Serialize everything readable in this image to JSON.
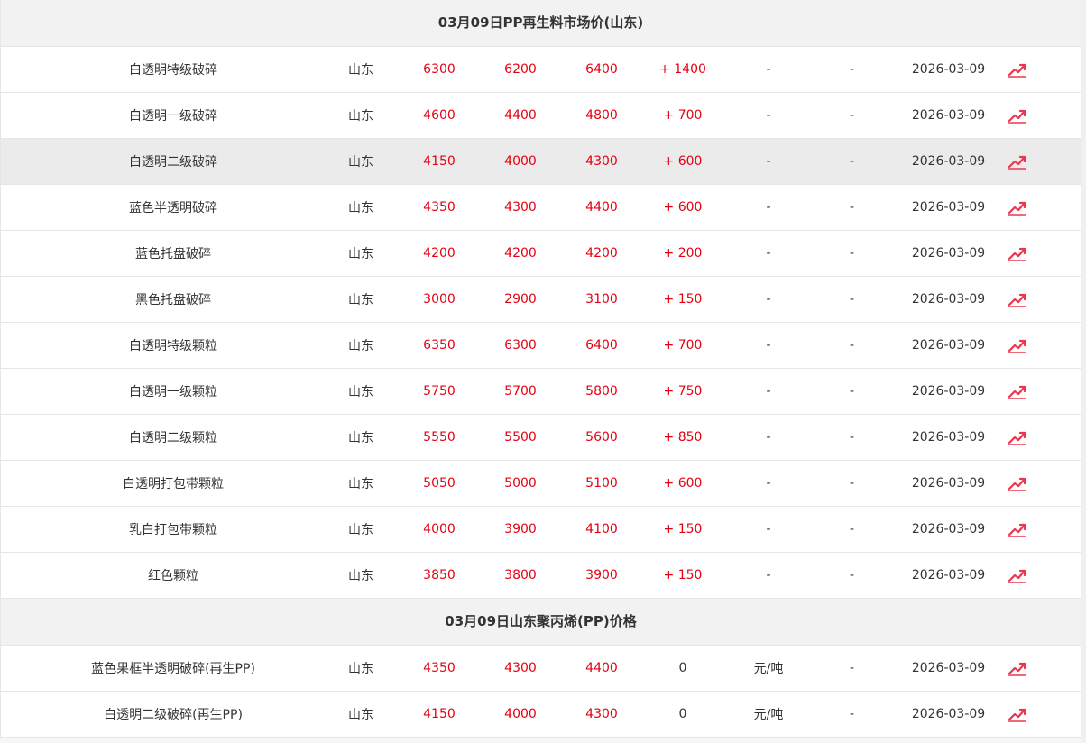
{
  "sections": [
    {
      "title": "03月09日PP再生料市场价(山东)",
      "rows": [
        {
          "name": "白透明特级破碎",
          "region": "山东",
          "p1": "6300",
          "p2": "6200",
          "p3": "6400",
          "change": "+ 1400",
          "unit": "-",
          "note": "-",
          "date": "2026-03-09"
        },
        {
          "name": "白透明一级破碎",
          "region": "山东",
          "p1": "4600",
          "p2": "4400",
          "p3": "4800",
          "change": "+ 700",
          "unit": "-",
          "note": "-",
          "date": "2026-03-09"
        },
        {
          "name": "白透明二级破碎",
          "region": "山东",
          "p1": "4150",
          "p2": "4000",
          "p3": "4300",
          "change": "+ 600",
          "unit": "-",
          "note": "-",
          "date": "2026-03-09"
        },
        {
          "name": "蓝色半透明破碎",
          "region": "山东",
          "p1": "4350",
          "p2": "4300",
          "p3": "4400",
          "change": "+ 600",
          "unit": "-",
          "note": "-",
          "date": "2026-03-09"
        },
        {
          "name": "蓝色托盘破碎",
          "region": "山东",
          "p1": "4200",
          "p2": "4200",
          "p3": "4200",
          "change": "+ 200",
          "unit": "-",
          "note": "-",
          "date": "2026-03-09"
        },
        {
          "name": "黑色托盘破碎",
          "region": "山东",
          "p1": "3000",
          "p2": "2900",
          "p3": "3100",
          "change": "+ 150",
          "unit": "-",
          "note": "-",
          "date": "2026-03-09"
        },
        {
          "name": "白透明特级颗粒",
          "region": "山东",
          "p1": "6350",
          "p2": "6300",
          "p3": "6400",
          "change": "+ 700",
          "unit": "-",
          "note": "-",
          "date": "2026-03-09"
        },
        {
          "name": "白透明一级颗粒",
          "region": "山东",
          "p1": "5750",
          "p2": "5700",
          "p3": "5800",
          "change": "+ 750",
          "unit": "-",
          "note": "-",
          "date": "2026-03-09"
        },
        {
          "name": "白透明二级颗粒",
          "region": "山东",
          "p1": "5550",
          "p2": "5500",
          "p3": "5600",
          "change": "+ 850",
          "unit": "-",
          "note": "-",
          "date": "2026-03-09"
        },
        {
          "name": "白透明打包带颗粒",
          "region": "山东",
          "p1": "5050",
          "p2": "5000",
          "p3": "5100",
          "change": "+ 600",
          "unit": "-",
          "note": "-",
          "date": "2026-03-09"
        },
        {
          "name": "乳白打包带颗粒",
          "region": "山东",
          "p1": "4000",
          "p2": "3900",
          "p3": "4100",
          "change": "+ 150",
          "unit": "-",
          "note": "-",
          "date": "2026-03-09"
        },
        {
          "name": "红色颗粒",
          "region": "山东",
          "p1": "3850",
          "p2": "3800",
          "p3": "3900",
          "change": "+ 150",
          "unit": "-",
          "note": "-",
          "date": "2026-03-09"
        }
      ]
    },
    {
      "title": "03月09日山东聚丙烯(PP)价格",
      "rows": [
        {
          "name": "蓝色果框半透明破碎(再生PP)",
          "region": "山东",
          "p1": "4350",
          "p2": "4300",
          "p3": "4400",
          "change": "0",
          "unit": "元/吨",
          "note": "-",
          "date": "2026-03-09"
        },
        {
          "name": "白透明二级破碎(再生PP)",
          "region": "山东",
          "p1": "4150",
          "p2": "4000",
          "p3": "4300",
          "change": "0",
          "unit": "元/吨",
          "note": "-",
          "date": "2026-03-09"
        }
      ]
    }
  ],
  "highlighted_row": {
    "section": 0,
    "row": 2
  },
  "colors": {
    "price": "#e60012",
    "icon": "#e8384f"
  },
  "icons": {
    "trend": "trend-chart-icon"
  }
}
